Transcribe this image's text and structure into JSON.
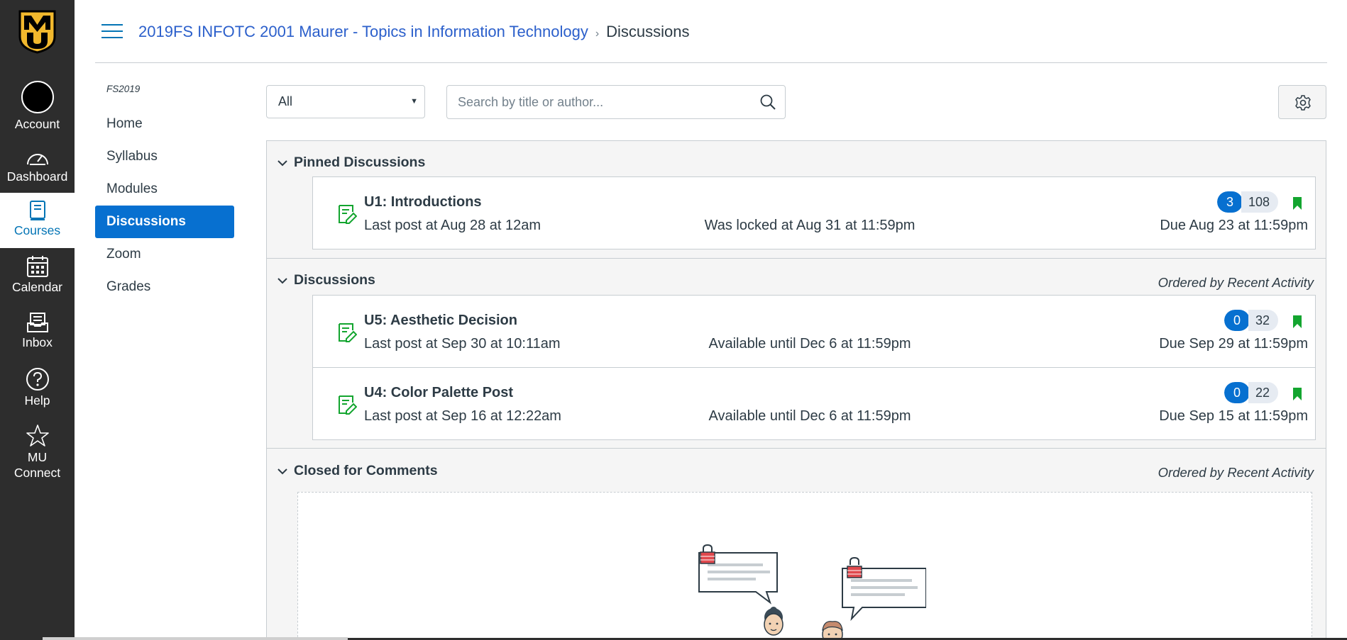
{
  "global_nav": {
    "logo": "MU-logo",
    "items": [
      {
        "label": "Account",
        "icon": "avatar"
      },
      {
        "label": "Dashboard",
        "icon": "dashboard-icon"
      },
      {
        "label": "Courses",
        "icon": "courses-icon",
        "active": true
      },
      {
        "label": "Calendar",
        "icon": "calendar-icon"
      },
      {
        "label": "Inbox",
        "icon": "inbox-icon"
      },
      {
        "label": "Help",
        "icon": "help-icon"
      },
      {
        "label": "MU Connect",
        "icon": "star-icon"
      }
    ]
  },
  "breadcrumb": {
    "course": "2019FS INFOTC 2001 Maurer - Topics in Information Technology",
    "separator": "›",
    "current": "Discussions"
  },
  "course_nav": {
    "term": "FS2019",
    "items": [
      {
        "label": "Home"
      },
      {
        "label": "Syllabus"
      },
      {
        "label": "Modules"
      },
      {
        "label": "Discussions",
        "active": true
      },
      {
        "label": "Zoom"
      },
      {
        "label": "Grades"
      }
    ]
  },
  "toolbar": {
    "filter_value": "All",
    "search_placeholder": "Search by title or author..."
  },
  "sections": {
    "pinned": {
      "title": "Pinned Discussions",
      "items": [
        {
          "title": "U1: Introductions",
          "last_post": "Last post at Aug 28 at 12am",
          "availability": "Was locked at Aug 31 at 11:59pm",
          "due": "Due Aug 23 at 11:59pm",
          "unread": "3",
          "total": "108"
        }
      ]
    },
    "discussions": {
      "title": "Discussions",
      "order": "Ordered by Recent Activity",
      "items": [
        {
          "title": "U5: Aesthetic Decision",
          "last_post": "Last post at Sep 30 at 10:11am",
          "availability": "Available until Dec 6 at 11:59pm",
          "due": "Due Sep 29 at 11:59pm",
          "unread": "0",
          "total": "32"
        },
        {
          "title": "U4: Color Palette Post",
          "last_post": "Last post at Sep 16 at 12:22am",
          "availability": "Available until Dec 6 at 11:59pm",
          "due": "Due Sep 15 at 11:59pm",
          "unread": "0",
          "total": "22"
        }
      ]
    },
    "closed": {
      "title": "Closed for Comments",
      "order": "Ordered by Recent Activity"
    }
  },
  "colors": {
    "nav_bg": "#2d2d2d",
    "brand_gold": "#f1b82d",
    "link_blue": "#2b5fcb",
    "active_blue": "#0770d0",
    "discussion_green": "#13a52f"
  }
}
